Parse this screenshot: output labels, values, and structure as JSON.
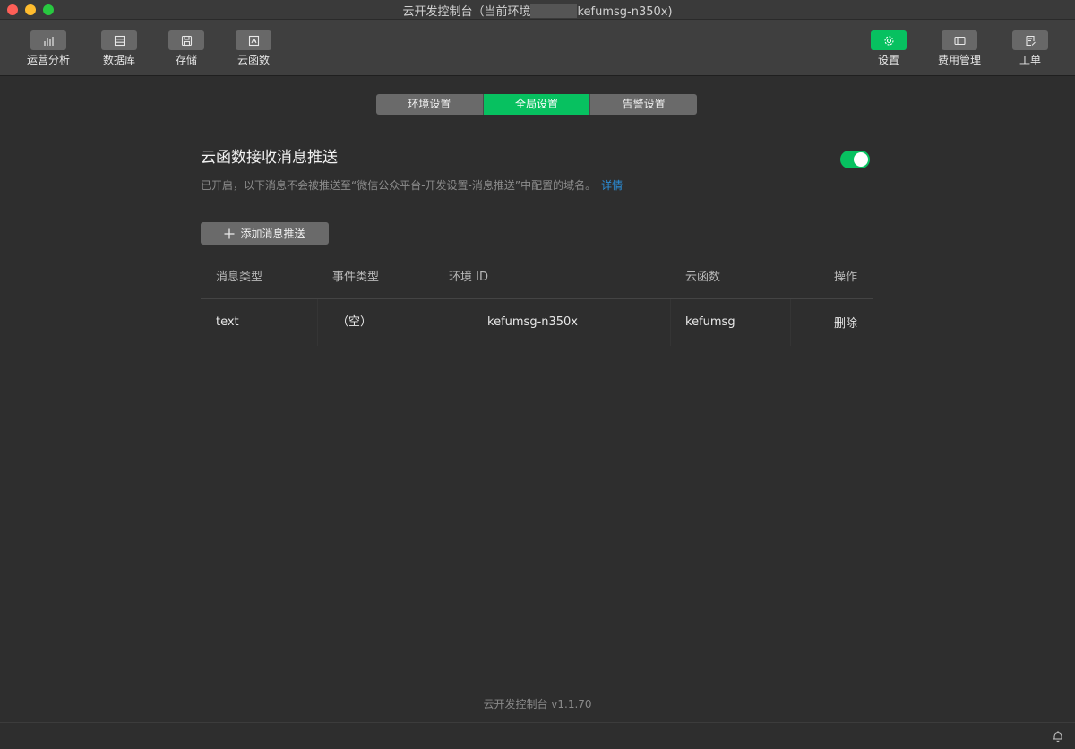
{
  "window": {
    "title_prefix": "云开发控制台（当前环境",
    "title_suffix": "kefumsg-n350x)"
  },
  "toolbar": {
    "left": [
      {
        "label": "运营分析",
        "icon": "bar-chart-icon"
      },
      {
        "label": "数据库",
        "icon": "database-icon"
      },
      {
        "label": "存储",
        "icon": "storage-icon"
      },
      {
        "label": "云函数",
        "icon": "cloud-function-icon"
      }
    ],
    "right": [
      {
        "label": "设置",
        "icon": "gear-icon",
        "active": true
      },
      {
        "label": "费用管理",
        "icon": "billing-icon"
      },
      {
        "label": "工单",
        "icon": "ticket-icon"
      }
    ]
  },
  "tabs": [
    {
      "label": "环境设置",
      "active": false
    },
    {
      "label": "全局设置",
      "active": true
    },
    {
      "label": "告警设置",
      "active": false
    }
  ],
  "section": {
    "title": "云函数接收消息推送",
    "desc": "已开启，以下消息不会被推送至“微信公众平台-开发设置-消息推送”中配置的域名。",
    "detail_link": "详情",
    "toggle_on": true
  },
  "add_button": {
    "label": "添加消息推送"
  },
  "table": {
    "headers": [
      "消息类型",
      "事件类型",
      "环境 ID",
      "云函数",
      "操作"
    ],
    "rows": [
      {
        "msg_type": "text",
        "event_type": "（空）",
        "env_id": "kefumsg-n350x",
        "function": "kefumsg",
        "action": "删除"
      }
    ]
  },
  "footer": {
    "version": "云开发控制台 v1.1.70"
  },
  "colors": {
    "accent": "#07c160",
    "link": "#2b8ed8",
    "background": "#2e2e2e"
  }
}
